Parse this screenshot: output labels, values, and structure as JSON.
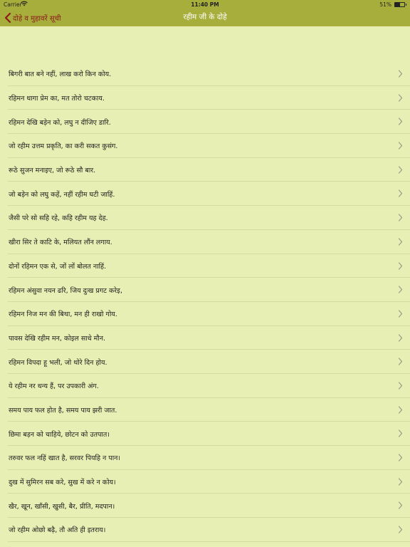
{
  "status": {
    "carrier": "Carrier",
    "time": "11:40 PM",
    "battery": "51%"
  },
  "nav": {
    "back_label": "दोहे व मुहावरें सूची",
    "title": "रहीम जी के दोहे"
  },
  "colors": {
    "bar": "#a7ae3c",
    "background": "#e8efb4",
    "back_text": "#8b1d1a"
  },
  "items": [
    {
      "label": "बिगरी बात बने नहीं, लाख करो किन कोय."
    },
    {
      "label": "रहिमन धागा प्रेम का, मत तोरो चटकाय."
    },
    {
      "label": "रहिमन देखि बड़ेन को, लघु न दीजिए डारि."
    },
    {
      "label": "जो रहीम उत्तम प्रकृति, का करी सकत कुसंग."
    },
    {
      "label": "रूठे सुजन मनाइए, जो रूठे सौ बार."
    },
    {
      "label": "जो बड़ेन को लघु कहें, नहीं रहीम घटी जाहिं."
    },
    {
      "label": "जैसी परे सो सहि रहे, कहि रहीम यह देह."
    },
    {
      "label": "खीरा सिर ते काटि के, मलियत लौंन लगाय."
    },
    {
      "label": "दोनों रहिमन एक से, जों लों बोलत नाहिं."
    },
    {
      "label": "रहिमन अंसुवा नयन ढरि, जिय दुःख प्रगट करेइ,"
    },
    {
      "label": "रहिमन निज मन की बिथा, मन ही राखो गोय."
    },
    {
      "label": "पावस देखि रहीम मन, कोइल साधे मौन."
    },
    {
      "label": "रहिमन विपदा हू भली, जो थोरे दिन होय."
    },
    {
      "label": "ये रहीम नर धन्य हैं, पर उपकारी अंग."
    },
    {
      "label": "समय पाय फल होत है, समय पाय झरी जात."
    },
    {
      "label": "छिमा बड़न को चाहिये, छोटन को उतपात।"
    },
    {
      "label": "तरुवर फल नहिं खात है, सरवर पियहि न पान।"
    },
    {
      "label": "दुख में सुमिरन सब करे, सुख में करे न कोय।"
    },
    {
      "label": "खैर, खून, खाँसी, खुसी, बैर, प्रीति, मदपान।"
    },
    {
      "label": "जो रहीम ओछो बढ़ै, तौ अति ही इतराय।"
    }
  ]
}
